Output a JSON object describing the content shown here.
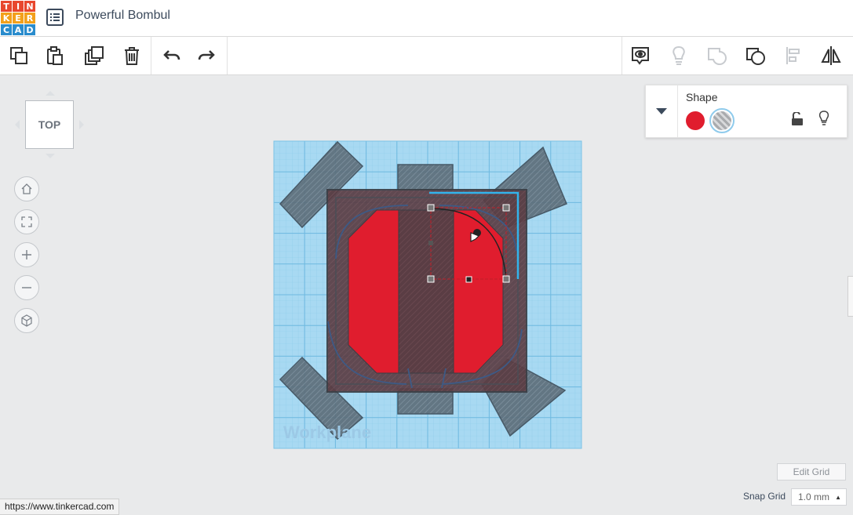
{
  "logo": {
    "letters": [
      "T",
      "I",
      "N",
      "K",
      "E",
      "R",
      "C",
      "A",
      "D"
    ],
    "colors": [
      "#e8472e",
      "#e8472e",
      "#e8472e",
      "#f3a01b",
      "#f3a01b",
      "#f3a01b",
      "#2a8ccd",
      "#2a8ccd",
      "#2a8ccd"
    ]
  },
  "header": {
    "title": "Powerful Bombul",
    "menu_icon": "list-icon"
  },
  "toolbar": {
    "left": [
      "copy-icon",
      "paste-icon",
      "duplicate-icon",
      "delete-icon",
      "undo-icon",
      "redo-icon"
    ],
    "right": [
      "notes-icon",
      "light-icon",
      "group-icon",
      "ungroup-icon",
      "align-icon",
      "mirror-icon"
    ]
  },
  "viewcube": {
    "face": "TOP"
  },
  "nav": [
    "home-icon",
    "fit-icon",
    "zoom-in-icon",
    "zoom-out-icon",
    "perspective-icon"
  ],
  "workplane": {
    "label": "Workplane"
  },
  "inspector": {
    "title": "Shape",
    "solid_color": "#e01d2e"
  },
  "grid": {
    "edit_label": "Edit Grid",
    "snap_label": "Snap Grid",
    "snap_value": "1.0 mm"
  },
  "status": {
    "url": "https://www.tinkercad.com"
  }
}
